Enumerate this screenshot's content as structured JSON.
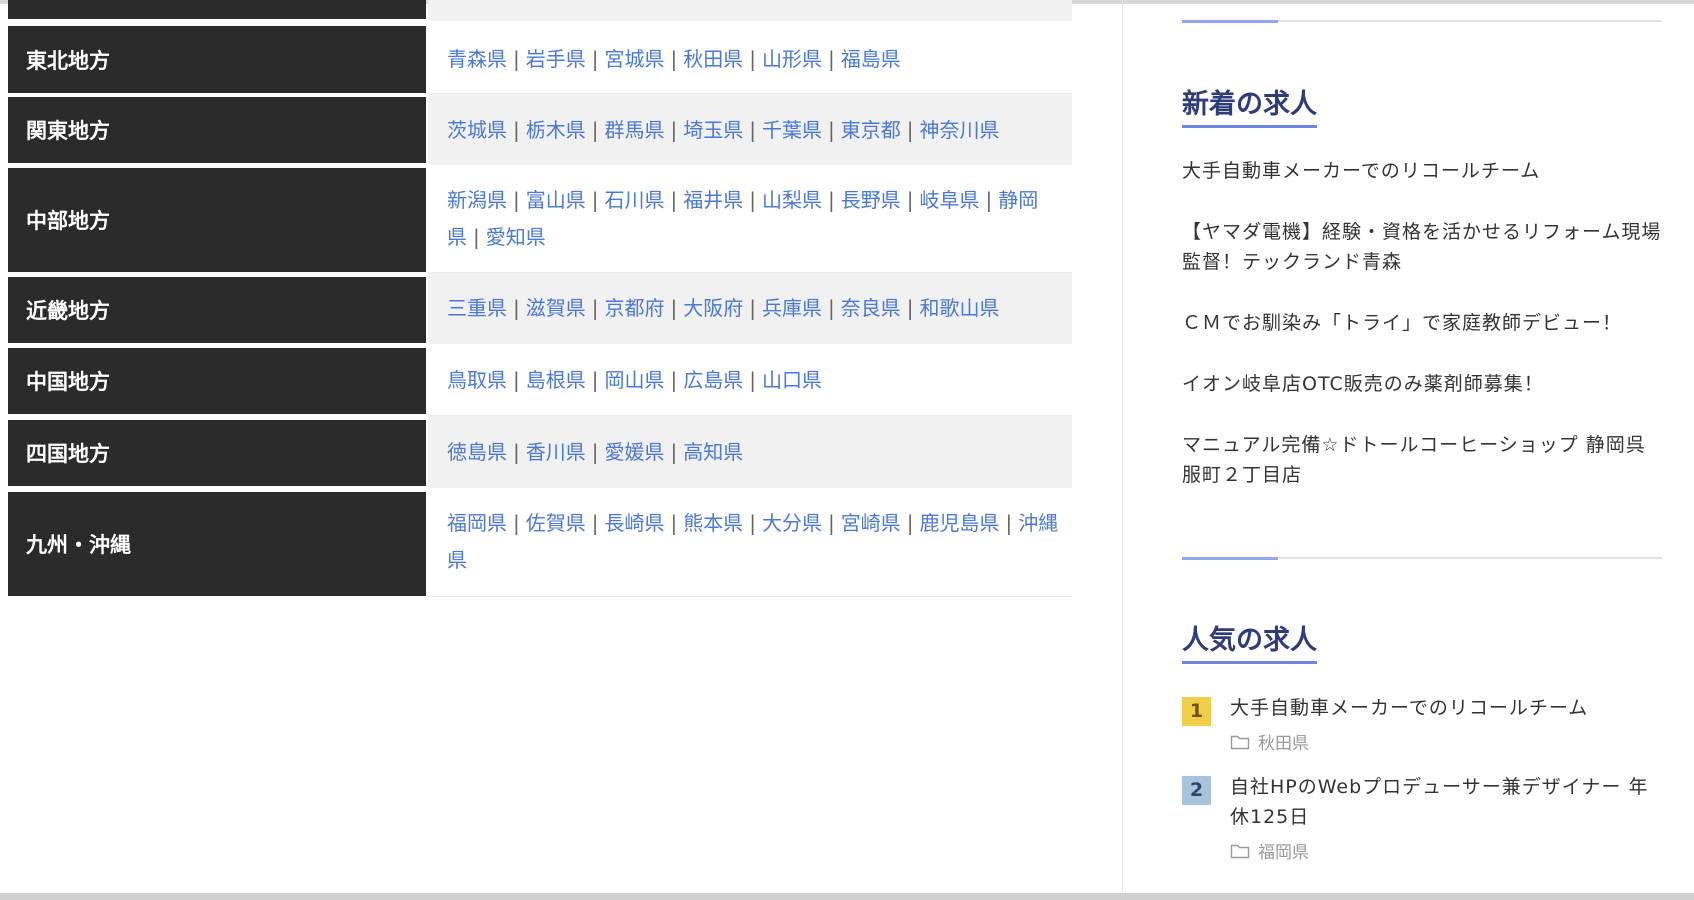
{
  "regions": [
    {
      "name": "",
      "prefectures": []
    },
    {
      "name": "東北地方",
      "prefectures": [
        "青森県",
        "岩手県",
        "宮城県",
        "秋田県",
        "山形県",
        "福島県"
      ]
    },
    {
      "name": "関東地方",
      "prefectures": [
        "茨城県",
        "栃木県",
        "群馬県",
        "埼玉県",
        "千葉県",
        "東京都",
        "神奈川県"
      ]
    },
    {
      "name": "中部地方",
      "prefectures": [
        "新潟県",
        "富山県",
        "石川県",
        "福井県",
        "山梨県",
        "長野県",
        "岐阜県",
        "静岡県",
        "愛知県"
      ]
    },
    {
      "name": "近畿地方",
      "prefectures": [
        "三重県",
        "滋賀県",
        "京都府",
        "大阪府",
        "兵庫県",
        "奈良県",
        "和歌山県"
      ]
    },
    {
      "name": "中国地方",
      "prefectures": [
        "鳥取県",
        "島根県",
        "岡山県",
        "広島県",
        "山口県"
      ]
    },
    {
      "name": "四国地方",
      "prefectures": [
        "徳島県",
        "香川県",
        "愛媛県",
        "高知県"
      ]
    },
    {
      "name": "九州・沖縄",
      "prefectures": [
        "福岡県",
        "佐賀県",
        "長崎県",
        "熊本県",
        "大分県",
        "宮崎県",
        "鹿児島県",
        "沖縄県"
      ]
    }
  ],
  "sidebar": {
    "new_jobs": {
      "title": "新着の求人",
      "items": [
        "大手自動車メーカーでのリコールチーム",
        "【ヤマダ電機】経験・資格を活かせるリフォーム現場監督！テックランド青森",
        "ＣＭでお馴染み「トライ」で家庭教師デビュー！",
        "イオン岐阜店OTC販売のみ薬剤師募集！",
        "マニュアル完備☆ドトールコーヒーショップ 静岡呉服町２丁目店"
      ]
    },
    "popular_jobs": {
      "title": "人気の求人",
      "items": [
        {
          "rank": "1",
          "title": "大手自動車メーカーでのリコールチーム",
          "category": "秋田県"
        },
        {
          "rank": "2",
          "title": "自社HPのWebプロデューサー兼デザイナー 年休125日",
          "category": "福岡県"
        }
      ]
    }
  },
  "colors": {
    "region_header_bg": "#2b2b2b",
    "link": "#4a78d6",
    "section_title": "#2e3c7a",
    "section_accent": "#6d86e0",
    "rank1_badge": "#f0ce4a",
    "rank2_badge": "#a9c3dd"
  },
  "icons": {
    "category": "folder-icon"
  }
}
